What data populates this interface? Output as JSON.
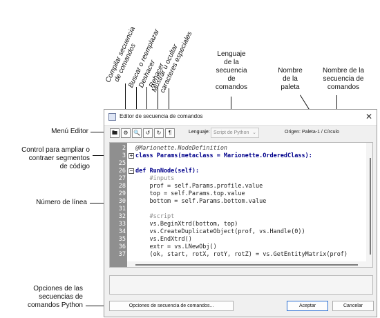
{
  "annotations": {
    "menu_editor": "Menú Editor",
    "code_segment_control": [
      "Control para ampliar o",
      "contraer segmentos",
      "de código"
    ],
    "line_number": "Número de línea",
    "python_options": [
      "Opciones de las",
      "secuencias de",
      "comandos Python"
    ],
    "compile": [
      "Compilar secuencia",
      "de comandos"
    ],
    "find_replace": "Buscar o reemplazar",
    "undo": "Deshacer",
    "redo": "Rehacer",
    "show_hide": [
      "Mostrar u ocultar",
      "caracteres especiales"
    ],
    "script_language": [
      "Lenguaje",
      "de la",
      "secuencia",
      "de",
      "comandos"
    ],
    "palette_name": [
      "Nombre",
      "de la",
      "paleta"
    ],
    "script_name": [
      "Nombre de la",
      "secuencia de",
      "comandos"
    ]
  },
  "window": {
    "title": "Editor de secuencia de comandos",
    "close_glyph": "✕"
  },
  "toolbar": {
    "menu_glyph": "🖿",
    "compile_glyph": "⚙",
    "find_glyph": "🔍",
    "undo_glyph": "↺",
    "redo_glyph": "↻",
    "pilcrow_glyph": "¶",
    "language_label": "Lenguaje:",
    "language_value": "Script de Python",
    "origin_text": "Origen: Paleta-1 / Círculo"
  },
  "editor": {
    "line_numbers": [
      "2",
      "3",
      "25",
      "26",
      "27",
      "28",
      "29",
      "30",
      "31",
      "32",
      "33",
      "34",
      "35",
      "36",
      "37"
    ],
    "lines": [
      "@Marionette.NodeDefinition",
      "class Params(metaclass = Marionette.OrderedClass):",
      "",
      "def RunNode(self):",
      "    #inputs",
      "    prof = self.Params.profile.value",
      "    top = self.Params.top.value",
      "    bottom = self.Params.bottom.value",
      "",
      "    #script",
      "    vs.BeginXtrd(bottom, top)",
      "    vs.CreateDuplicateObject(prof, vs.Handle(0))",
      "    vs.EndXtrd()",
      "    extr = vs.LNewObj()",
      "    (ok, start, rotX, rotY, rotZ) = vs.GetEntityMatrix(prof)"
    ],
    "fold_glyph": "+",
    "fold_glyph_open": "−"
  },
  "buttons": {
    "options": "Opciones de secuencia de comandos...",
    "accept": "Aceptar",
    "cancel": "Cancelar"
  }
}
